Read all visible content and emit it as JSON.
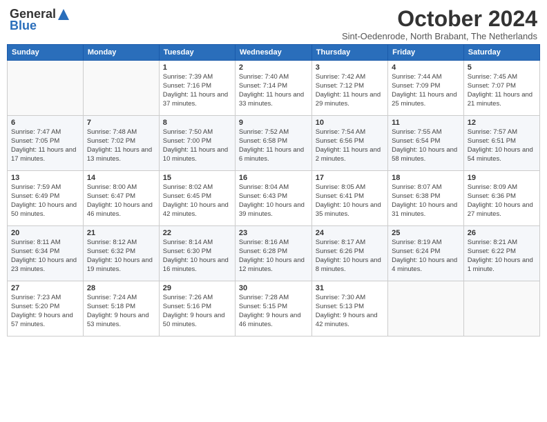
{
  "header": {
    "logo_general": "General",
    "logo_blue": "Blue",
    "title": "October 2024",
    "subtitle": "Sint-Oedenrode, North Brabant, The Netherlands"
  },
  "weekdays": [
    "Sunday",
    "Monday",
    "Tuesday",
    "Wednesday",
    "Thursday",
    "Friday",
    "Saturday"
  ],
  "weeks": [
    [
      {
        "day": "",
        "info": ""
      },
      {
        "day": "",
        "info": ""
      },
      {
        "day": "1",
        "info": "Sunrise: 7:39 AM\nSunset: 7:16 PM\nDaylight: 11 hours and 37 minutes."
      },
      {
        "day": "2",
        "info": "Sunrise: 7:40 AM\nSunset: 7:14 PM\nDaylight: 11 hours and 33 minutes."
      },
      {
        "day": "3",
        "info": "Sunrise: 7:42 AM\nSunset: 7:12 PM\nDaylight: 11 hours and 29 minutes."
      },
      {
        "day": "4",
        "info": "Sunrise: 7:44 AM\nSunset: 7:09 PM\nDaylight: 11 hours and 25 minutes."
      },
      {
        "day": "5",
        "info": "Sunrise: 7:45 AM\nSunset: 7:07 PM\nDaylight: 11 hours and 21 minutes."
      }
    ],
    [
      {
        "day": "6",
        "info": "Sunrise: 7:47 AM\nSunset: 7:05 PM\nDaylight: 11 hours and 17 minutes."
      },
      {
        "day": "7",
        "info": "Sunrise: 7:48 AM\nSunset: 7:02 PM\nDaylight: 11 hours and 13 minutes."
      },
      {
        "day": "8",
        "info": "Sunrise: 7:50 AM\nSunset: 7:00 PM\nDaylight: 11 hours and 10 minutes."
      },
      {
        "day": "9",
        "info": "Sunrise: 7:52 AM\nSunset: 6:58 PM\nDaylight: 11 hours and 6 minutes."
      },
      {
        "day": "10",
        "info": "Sunrise: 7:54 AM\nSunset: 6:56 PM\nDaylight: 11 hours and 2 minutes."
      },
      {
        "day": "11",
        "info": "Sunrise: 7:55 AM\nSunset: 6:54 PM\nDaylight: 10 hours and 58 minutes."
      },
      {
        "day": "12",
        "info": "Sunrise: 7:57 AM\nSunset: 6:51 PM\nDaylight: 10 hours and 54 minutes."
      }
    ],
    [
      {
        "day": "13",
        "info": "Sunrise: 7:59 AM\nSunset: 6:49 PM\nDaylight: 10 hours and 50 minutes."
      },
      {
        "day": "14",
        "info": "Sunrise: 8:00 AM\nSunset: 6:47 PM\nDaylight: 10 hours and 46 minutes."
      },
      {
        "day": "15",
        "info": "Sunrise: 8:02 AM\nSunset: 6:45 PM\nDaylight: 10 hours and 42 minutes."
      },
      {
        "day": "16",
        "info": "Sunrise: 8:04 AM\nSunset: 6:43 PM\nDaylight: 10 hours and 39 minutes."
      },
      {
        "day": "17",
        "info": "Sunrise: 8:05 AM\nSunset: 6:41 PM\nDaylight: 10 hours and 35 minutes."
      },
      {
        "day": "18",
        "info": "Sunrise: 8:07 AM\nSunset: 6:38 PM\nDaylight: 10 hours and 31 minutes."
      },
      {
        "day": "19",
        "info": "Sunrise: 8:09 AM\nSunset: 6:36 PM\nDaylight: 10 hours and 27 minutes."
      }
    ],
    [
      {
        "day": "20",
        "info": "Sunrise: 8:11 AM\nSunset: 6:34 PM\nDaylight: 10 hours and 23 minutes."
      },
      {
        "day": "21",
        "info": "Sunrise: 8:12 AM\nSunset: 6:32 PM\nDaylight: 10 hours and 19 minutes."
      },
      {
        "day": "22",
        "info": "Sunrise: 8:14 AM\nSunset: 6:30 PM\nDaylight: 10 hours and 16 minutes."
      },
      {
        "day": "23",
        "info": "Sunrise: 8:16 AM\nSunset: 6:28 PM\nDaylight: 10 hours and 12 minutes."
      },
      {
        "day": "24",
        "info": "Sunrise: 8:17 AM\nSunset: 6:26 PM\nDaylight: 10 hours and 8 minutes."
      },
      {
        "day": "25",
        "info": "Sunrise: 8:19 AM\nSunset: 6:24 PM\nDaylight: 10 hours and 4 minutes."
      },
      {
        "day": "26",
        "info": "Sunrise: 8:21 AM\nSunset: 6:22 PM\nDaylight: 10 hours and 1 minute."
      }
    ],
    [
      {
        "day": "27",
        "info": "Sunrise: 7:23 AM\nSunset: 5:20 PM\nDaylight: 9 hours and 57 minutes."
      },
      {
        "day": "28",
        "info": "Sunrise: 7:24 AM\nSunset: 5:18 PM\nDaylight: 9 hours and 53 minutes."
      },
      {
        "day": "29",
        "info": "Sunrise: 7:26 AM\nSunset: 5:16 PM\nDaylight: 9 hours and 50 minutes."
      },
      {
        "day": "30",
        "info": "Sunrise: 7:28 AM\nSunset: 5:15 PM\nDaylight: 9 hours and 46 minutes."
      },
      {
        "day": "31",
        "info": "Sunrise: 7:30 AM\nSunset: 5:13 PM\nDaylight: 9 hours and 42 minutes."
      },
      {
        "day": "",
        "info": ""
      },
      {
        "day": "",
        "info": ""
      }
    ]
  ]
}
